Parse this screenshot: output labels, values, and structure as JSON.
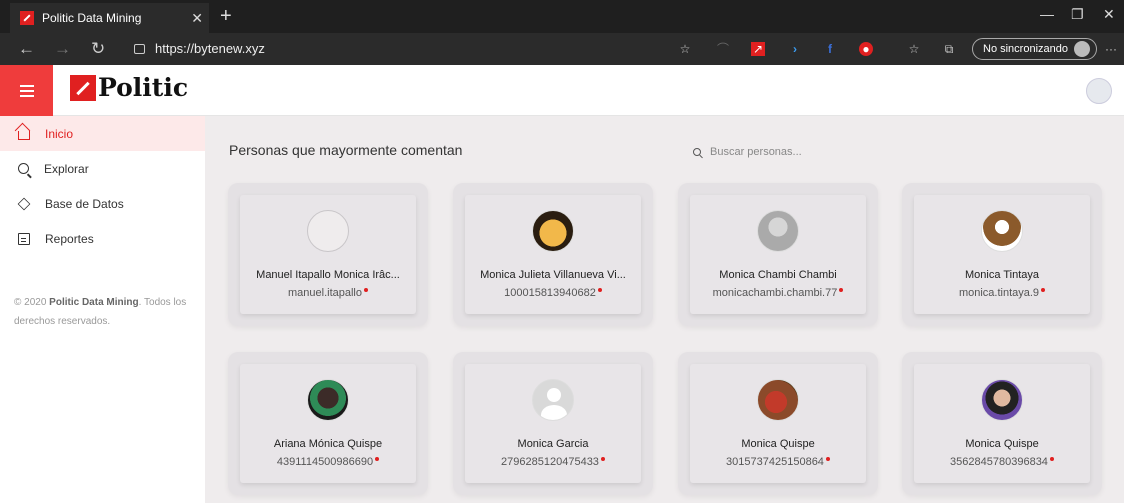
{
  "browser": {
    "tab_title": "Politic Data Mining",
    "url": "https://bytenew.xyz",
    "sync_label": "No sincronizando"
  },
  "app": {
    "logo_text": "Politic",
    "brand_color": "#ef3c3c"
  },
  "sidebar": {
    "items": [
      {
        "label": "Inicio",
        "icon": "home-icon",
        "active": true
      },
      {
        "label": "Explorar",
        "icon": "search-icon",
        "active": false
      },
      {
        "label": "Base de Datos",
        "icon": "layers-icon",
        "active": false
      },
      {
        "label": "Reportes",
        "icon": "clipboard-icon",
        "active": false
      }
    ],
    "copyright_prefix": "© 2020 ",
    "copyright_brand": "Politic Data Mining",
    "copyright_suffix": ". Todos los derechos reservados."
  },
  "main": {
    "title": "Personas que mayormente comentan",
    "search_placeholder": "Buscar personas...",
    "people": [
      {
        "name": "Manuel Itapallo Monica Irâc...",
        "handle": "manuel.itapallo",
        "avatar": "empty"
      },
      {
        "name": "Monica Julieta Villanueva Vi...",
        "handle": "100015813940682",
        "avatar": "gold"
      },
      {
        "name": "Monica Chambi Chambi",
        "handle": "monicachambi.chambi.77",
        "avatar": "grey"
      },
      {
        "name": "Monica Tintaya",
        "handle": "monica.tintaya.9",
        "avatar": "brown"
      },
      {
        "name": "Ariana Mónica Quispe",
        "handle": "4391114500986690",
        "avatar": "green"
      },
      {
        "name": "Monica Garcia",
        "handle": "2796285120475433",
        "avatar": "silhouette"
      },
      {
        "name": "Monica Quispe",
        "handle": "3015737425150864",
        "avatar": "red"
      },
      {
        "name": "Monica Quispe",
        "handle": "3562845780396834",
        "avatar": "purple"
      }
    ]
  }
}
